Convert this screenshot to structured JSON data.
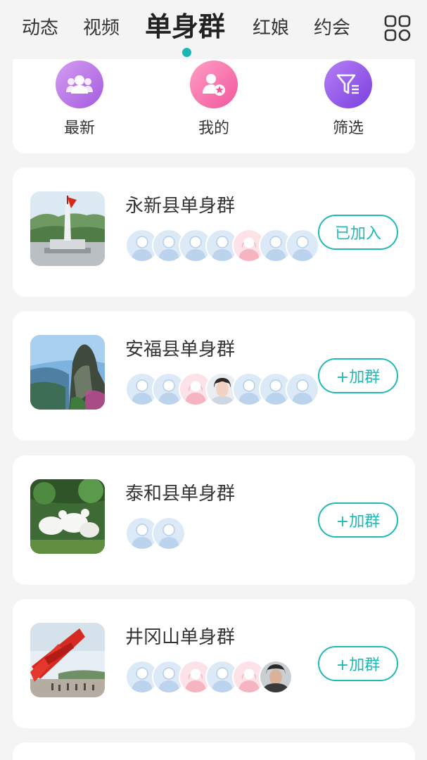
{
  "nav": {
    "tabs": [
      "动态",
      "视频",
      "单身群",
      "红娘",
      "约会"
    ],
    "active_tab": "单身群",
    "accent": "#19b8b5",
    "menu_icon": "grid-icon"
  },
  "filters": [
    {
      "label": "最新",
      "icon": "users-icon"
    },
    {
      "label": "我的",
      "icon": "user-star-icon"
    },
    {
      "label": "筛选",
      "icon": "filter-icon"
    }
  ],
  "groups": [
    {
      "name": "永新县单身群",
      "button": "已加入",
      "joined": true,
      "members": [
        "male",
        "male",
        "male",
        "male",
        "female",
        "male",
        "male"
      ]
    },
    {
      "name": "安福县单身群",
      "button": "+加群",
      "joined": false,
      "members": [
        "male",
        "male",
        "female",
        "photo",
        "male",
        "male",
        "male"
      ]
    },
    {
      "name": "泰和县单身群",
      "button": "+加群",
      "joined": false,
      "members": [
        "male",
        "male"
      ]
    },
    {
      "name": "井冈山单身群",
      "button": "+加群",
      "joined": false,
      "members": [
        "male",
        "male",
        "female",
        "male",
        "female",
        "photo"
      ]
    }
  ]
}
